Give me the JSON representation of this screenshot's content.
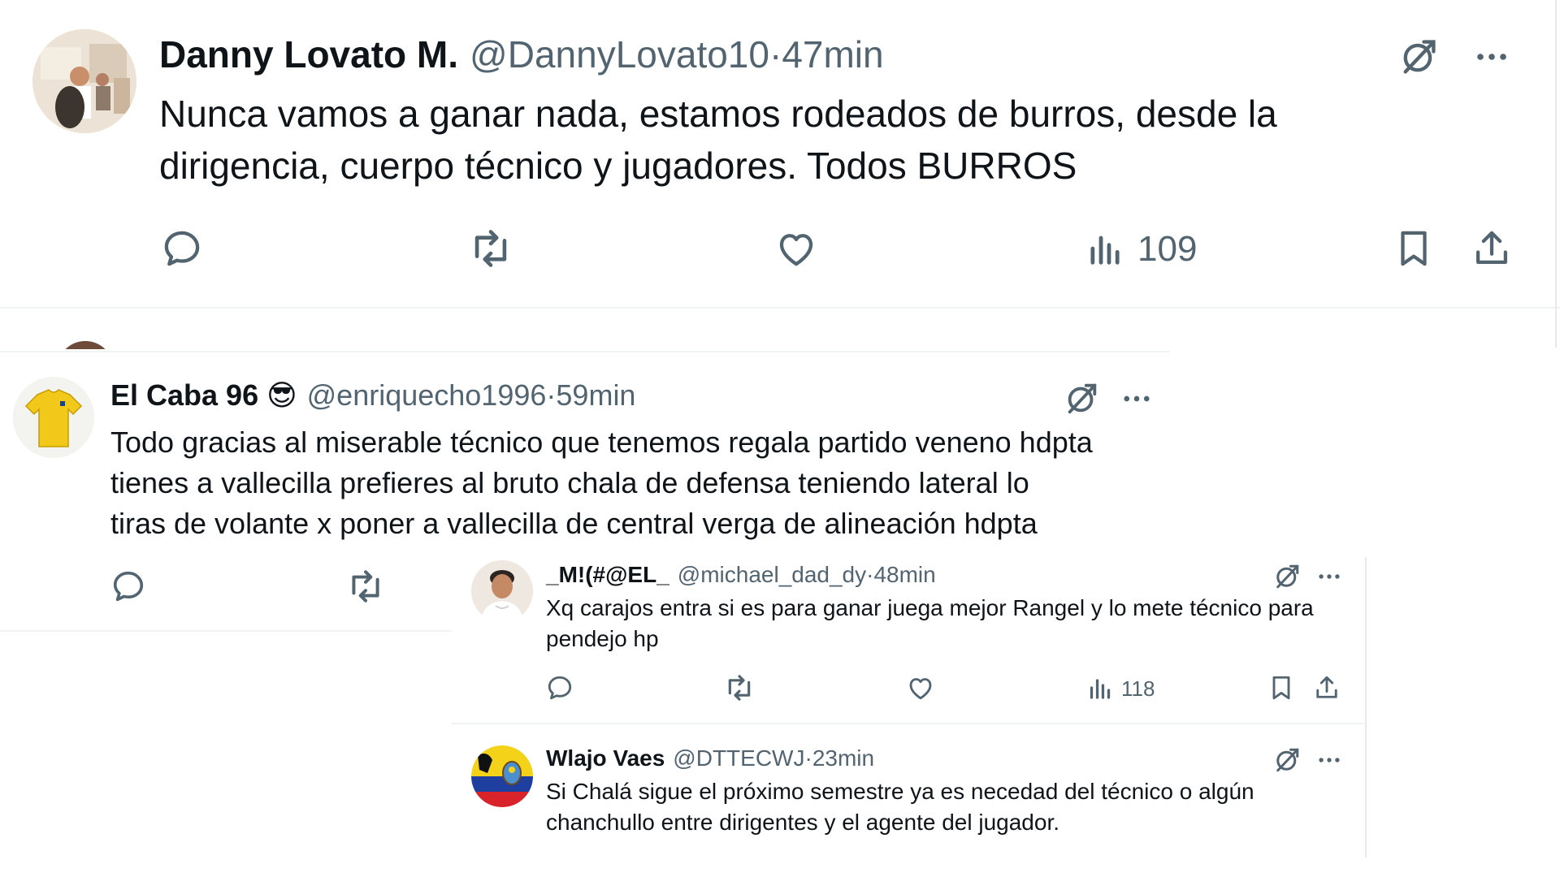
{
  "tweets": [
    {
      "name": "Danny Lovato M.",
      "handle": "@DannyLovato10",
      "sep": " · ",
      "time": "47min",
      "text_line1": "Nunca vamos a ganar nada, estamos rodeados de burros, desde la",
      "text_line2": "dirigencia, cuerpo técnico y jugadores. Todos BURROS",
      "views": "109"
    },
    {
      "name": "El Caba 96",
      "name_emoji": "😎",
      "handle": "@enriquecho1996",
      "sep": " · ",
      "time": "59min",
      "text_line1": "Todo gracias al miserable técnico que tenemos regala partido veneno hdpta",
      "text_line2": "tienes a vallecilla prefieres al bruto chala de defensa teniendo lateral lo",
      "text_line3": "tiras de volante x poner a vallecilla de central verga de alineación hdpta"
    },
    {
      "name": "_M!(#@EL_",
      "handle": "@michael_dad_dy",
      "sep": " · ",
      "time": "48min",
      "text_line1": "Xq carajos entra si es para ganar juega mejor Rangel y lo mete técnico para",
      "text_line2": "pendejo hp",
      "views": "118"
    },
    {
      "name": "Wlajo Vaes",
      "handle": "@DTTECWJ",
      "sep": " · ",
      "time": "23min",
      "text_line1": "Si Chalá sigue el próximo semestre ya es necedad del técnico o algún",
      "text_line2": "chanchullo entre dirigentes y el agente del jugador."
    }
  ],
  "icons": {
    "reply": "reply-icon",
    "retweet": "retweet-icon",
    "like": "like-icon",
    "views": "views-icon",
    "bookmark": "bookmark-icon",
    "share": "share-icon",
    "grok": "grok-icon",
    "more": "more-icon"
  },
  "colors": {
    "text_primary": "#0f1419",
    "text_secondary": "#536471",
    "divider": "#eff3f4"
  }
}
